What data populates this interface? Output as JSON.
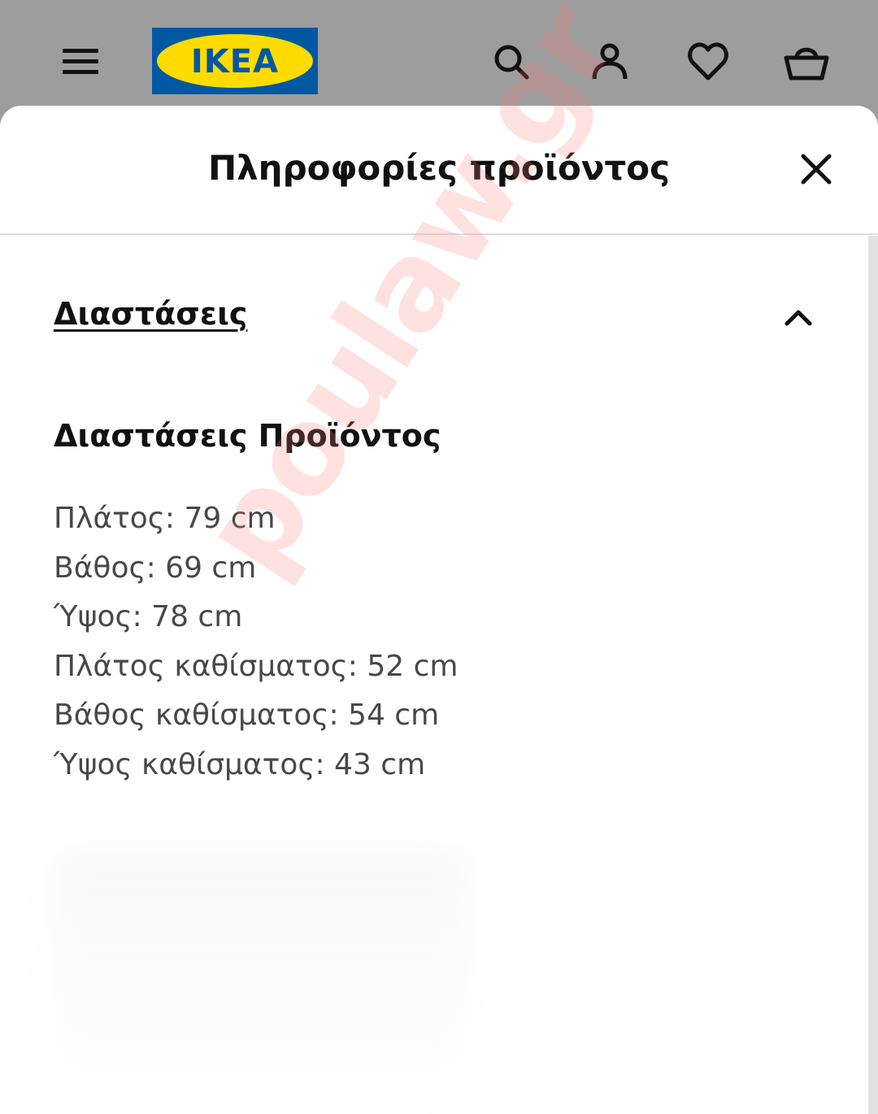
{
  "header": {
    "logo_text": "IKEA",
    "icons": [
      "menu-icon",
      "search-icon",
      "account-icon",
      "heart-icon",
      "basket-icon"
    ],
    "colors": {
      "logo_blue": "#0058a3",
      "logo_yellow": "#ffdb00",
      "header_bg": "#9d9d9d"
    }
  },
  "sheet": {
    "title": "Πληροφορίες προϊόντος",
    "close_icon": "close-icon"
  },
  "accordion": {
    "title": "Διαστάσεις",
    "state": "expanded",
    "section_title": "Διαστάσεις Προϊόντος",
    "rows": [
      "Πλάτος: 79 cm",
      "Βάθος: 69 cm",
      "Ύψος: 78 cm",
      "Πλάτος καθίσματος: 52 cm",
      "Βάθος καθίσματος: 54 cm",
      "Ύψος καθίσματος: 43 cm"
    ]
  },
  "watermark": "poulaw.gr"
}
